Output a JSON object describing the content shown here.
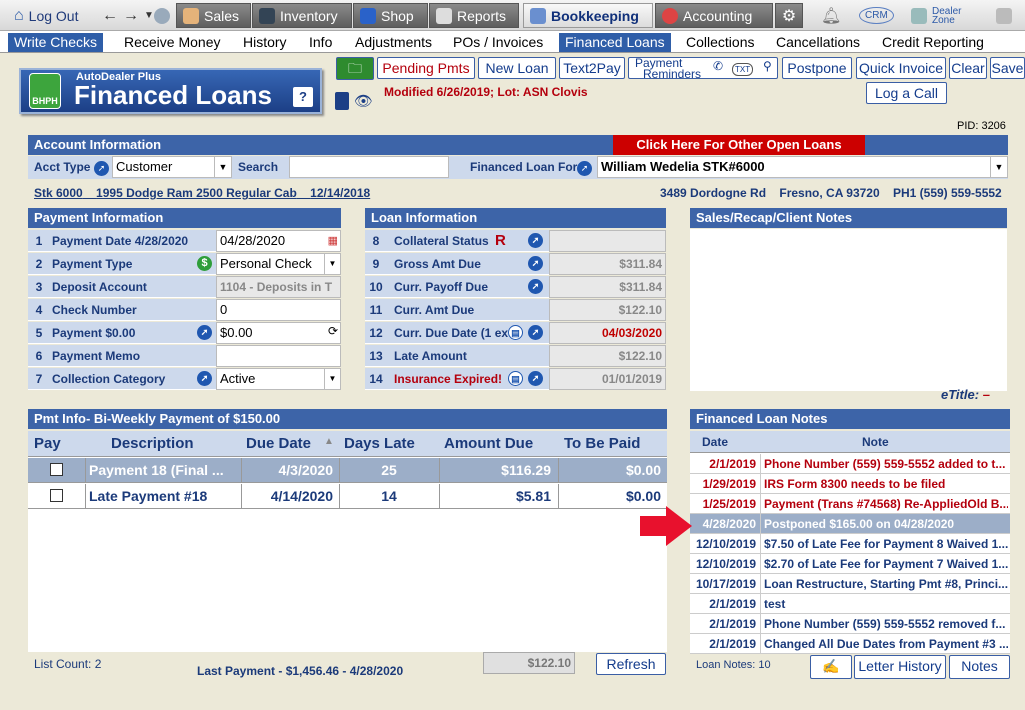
{
  "topnav": {
    "logout": "Log Out",
    "sales": "Sales",
    "inventory": "Inventory",
    "shop": "Shop",
    "reports": "Reports",
    "bookkeeping": "Bookkeeping",
    "accounting": "Accounting",
    "crm": "CRM",
    "dealerzone": "Dealer Zone"
  },
  "subnav": [
    "Write Checks",
    "Receive Money",
    "History",
    "Info",
    "Adjustments",
    "POs / Invoices",
    "Financed Loans",
    "Collections",
    "Cancellations",
    "Credit Reporting"
  ],
  "logo": {
    "small": "AutoDealer Plus",
    "big": "Financed Loans",
    "badge": "BHPH",
    "help": "?"
  },
  "toolbar": {
    "pending": "Pending Pmts",
    "newloan": "New Loan",
    "text2pay": "Text2Pay",
    "reminders1": "Payment",
    "reminders2": "Reminders",
    "txt": "TXT",
    "postpone": "Postpone",
    "quickinvoice": "Quick Invoice",
    "clear": "Clear",
    "save": "Save",
    "logcall": "Log a Call"
  },
  "modified": "Modified 6/26/2019; Lot: ASN Clovis",
  "pid": "PID: 3206",
  "account": {
    "title": "Account Information",
    "other_loans": "Click Here For Other Open Loans",
    "accttype_label": "Acct Type",
    "accttype": "Customer",
    "search_label": "Search",
    "search": "",
    "for_label": "Financed Loan For",
    "for": "William Wedelia  STK#6000"
  },
  "vehicle": {
    "stk": "Stk 6000",
    "desc": "1995 Dodge Ram 2500 Regular Cab",
    "date": "12/14/2018",
    "address": "3489 Dordogne Rd",
    "city": "Fresno, CA 93720",
    "phone": "PH1 (559) 559-5552"
  },
  "payment": {
    "title": "Payment Information",
    "rows": [
      {
        "n": "1",
        "label": "Payment Date  4/28/2020",
        "value": "04/28/2020"
      },
      {
        "n": "2",
        "label": "Payment Type",
        "value": "Personal Check"
      },
      {
        "n": "3",
        "label": "Deposit Account",
        "value": "1104 - Deposits in T"
      },
      {
        "n": "4",
        "label": "Check Number",
        "value": "0"
      },
      {
        "n": "5",
        "label": "Payment  $0.00",
        "value": "$0.00"
      },
      {
        "n": "6",
        "label": "Payment Memo",
        "value": ""
      },
      {
        "n": "7",
        "label": "Collection Category",
        "value": "Active"
      }
    ]
  },
  "loan": {
    "title": "Loan Information",
    "rows": [
      {
        "n": "8",
        "label": "Collateral Status",
        "flag": "R",
        "value": ""
      },
      {
        "n": "9",
        "label": "Gross Amt Due",
        "value": "$311.84"
      },
      {
        "n": "10",
        "label": "Curr. Payoff Due",
        "value": "$311.84"
      },
      {
        "n": "11",
        "label": "Curr. Amt Due",
        "value": "$122.10"
      },
      {
        "n": "12",
        "label": "Curr. Due Date (1 ex",
        "value": "04/03/2020"
      },
      {
        "n": "13",
        "label": "Late Amount",
        "value": "$122.10"
      },
      {
        "n": "14",
        "label": "Insurance Expired!",
        "value": "01/01/2019"
      }
    ]
  },
  "recap_title": "Sales/Recap/Client Notes",
  "etitle": "eTitle:",
  "etitle_value": "–",
  "pmt": {
    "title": "Pmt Info- Bi-Weekly Payment of $150.00",
    "cols": [
      "Pay",
      "Description",
      "Due Date",
      "Days Late",
      "Amount Due",
      "To Be Paid"
    ],
    "rows": [
      {
        "desc": "Payment 18 (Final ...",
        "due": "4/3/2020",
        "late": "25",
        "amt": "$116.29",
        "paid": "$0.00"
      },
      {
        "desc": "Late Payment #18",
        "due": "4/14/2020",
        "late": "14",
        "amt": "$5.81",
        "paid": "$0.00"
      }
    ]
  },
  "footer": {
    "count": "List Count:  2",
    "last": "Last Payment - $1,456.46 - 4/28/2020",
    "total": "$122.10",
    "refresh": "Refresh",
    "loannotes": "Loan Notes:  10",
    "letter": "Letter History",
    "notes": "Notes"
  },
  "notes": {
    "title": "Financed Loan Notes",
    "cols": [
      "Date",
      "Note"
    ],
    "rows": [
      {
        "date": "2/1/2019",
        "note": "Phone Number (559) 559-5552 added to t...",
        "kind": "red"
      },
      {
        "date": "1/29/2019",
        "note": "IRS Form 8300 needs to be filed",
        "kind": "red"
      },
      {
        "date": "1/25/2019",
        "note": "Payment (Trans #74568) Re-AppliedOld B...",
        "kind": "red"
      },
      {
        "date": "4/28/2020",
        "note": "Postponed $165.00 on 04/28/2020",
        "kind": "sel"
      },
      {
        "date": "12/10/2019",
        "note": "$7.50 of Late Fee for Payment 8 Waived 1...",
        "kind": "blue"
      },
      {
        "date": "12/10/2019",
        "note": "$2.70 of Late Fee for Payment 7 Waived 1...",
        "kind": "blue"
      },
      {
        "date": "10/17/2019",
        "note": "Loan Restructure, Starting Pmt #8, Princi...",
        "kind": "blue"
      },
      {
        "date": "2/1/2019",
        "note": "test",
        "kind": "blue"
      },
      {
        "date": "2/1/2019",
        "note": "Phone Number (559) 559-5552 removed f...",
        "kind": "blue"
      },
      {
        "date": "2/1/2019",
        "note": "Changed All Due Dates from Payment #3 ...",
        "kind": "blue"
      }
    ]
  }
}
